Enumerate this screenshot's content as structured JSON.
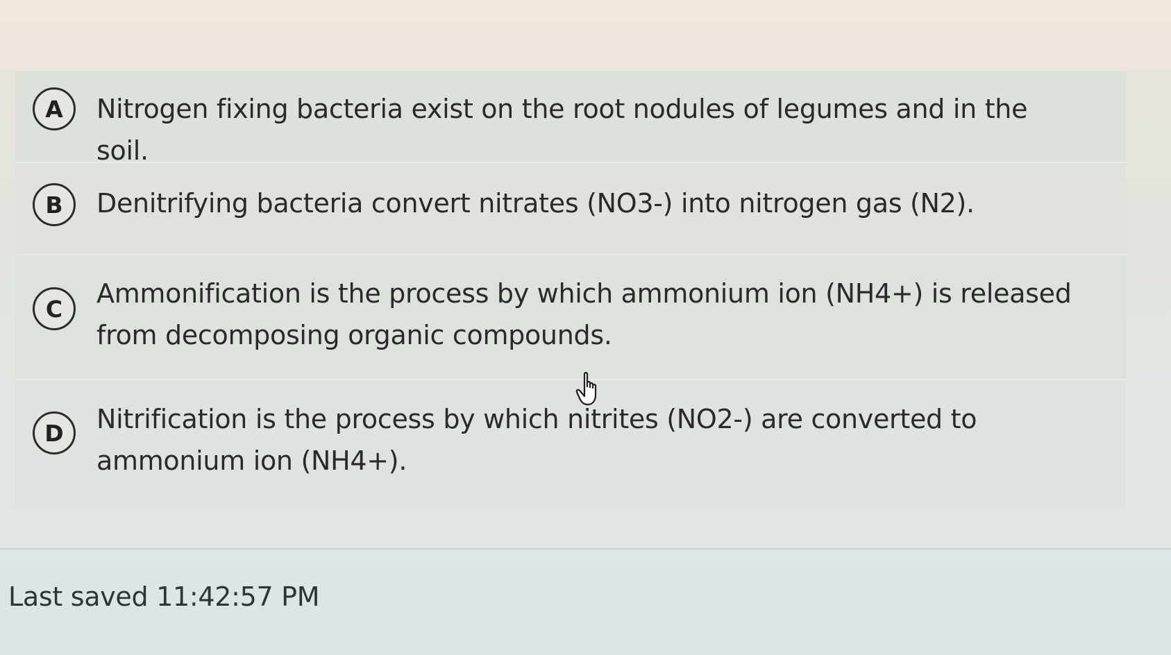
{
  "question": {
    "options": [
      {
        "letter": "A",
        "text": "Nitrogen fixing bacteria exist on the root nodules of legumes and in the soil."
      },
      {
        "letter": "B",
        "text": "Denitrifying bacteria convert nitrates (NO3-) into nitrogen gas (N2)."
      },
      {
        "letter": "C",
        "text": "Ammonification is the process by which ammonium ion (NH4+) is released from decomposing organic compounds."
      },
      {
        "letter": "D",
        "text": "Nitrification is the process by which nitrites (NO2-) are converted to ammonium ion (NH4+)."
      }
    ]
  },
  "footer": {
    "last_saved": "Last saved 11:42:57 PM"
  },
  "cursor": {
    "icon": "hand-pointer-icon"
  },
  "colors": {
    "text": "#2a2a2a",
    "option_background": "#dde2dd",
    "footer_background": "#dde6e8"
  }
}
